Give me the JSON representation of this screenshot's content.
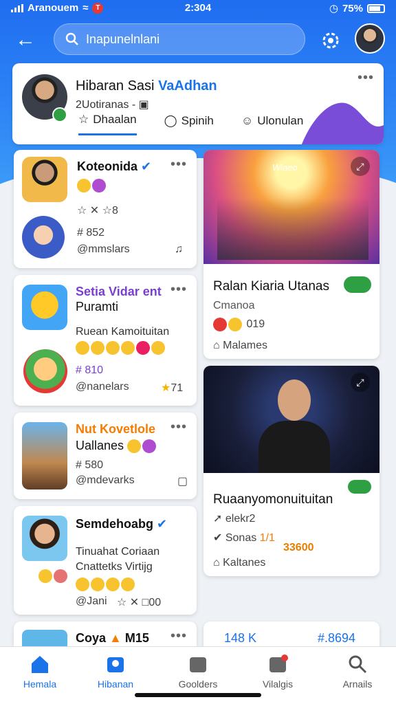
{
  "status": {
    "carrier": "Aranouem",
    "time": "2:304",
    "battery": "75%"
  },
  "search": {
    "placeholder": "Inapunelnlani"
  },
  "header_card": {
    "title_a": "Hibaran Sasi ",
    "title_b": "VaAdhan",
    "subtitle": "2Uotiranas -",
    "tabs": [
      "Dhaalan",
      "Spinih",
      "Ulonulan"
    ]
  },
  "left_cards": [
    {
      "title": "Koteonida",
      "stat": "# 852",
      "handle": "@mmslars"
    },
    {
      "title_a": "Setia Vidar ent",
      "title_b": "Puramti",
      "line": "Ruean Kamoituitan",
      "stat": "# 810",
      "handle": "@nanelars",
      "count": "71"
    },
    {
      "title_a": "Nut Kovetlole",
      "title_b": "Uallanes",
      "stat": "# 580",
      "handle": "@mdevarks"
    },
    {
      "title": "Semdehoabg",
      "line1": "Tinuahat Coriaan",
      "line2": "Cnattetks Virtijg",
      "handle": "@Jani",
      "count": "00"
    },
    {
      "title": "Coya",
      "extra": "M15"
    }
  ],
  "right_cards": [
    {
      "badge": "Wiaeo",
      "title": "Ralan Kiaria Utanas",
      "sub": "Cmanoa",
      "count": "019",
      "footer": "Malames"
    },
    {
      "title": "Ruaanyomonuituitan",
      "line1": "elekr2",
      "line2": "Sonas",
      "num": "1/1",
      "num2": "33600",
      "footer": "Kaltanes"
    },
    {
      "title": "148 K",
      "extra": "#.8694"
    }
  ],
  "nav": [
    "Hemala",
    "Hibanan",
    "Goolders",
    "Vilalgis",
    "Arnails"
  ],
  "colors": {
    "primary": "#1a73e8",
    "band": "#2f86f6"
  }
}
